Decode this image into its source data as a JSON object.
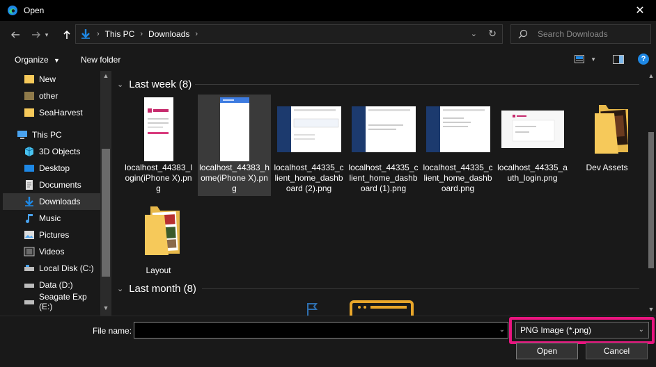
{
  "window": {
    "title": "Open"
  },
  "address": {
    "crumbs": [
      "This PC",
      "Downloads"
    ],
    "search_placeholder": "Search Downloads"
  },
  "toolbar": {
    "organize_label": "Organize",
    "new_folder_label": "New folder",
    "help_glyph": "?"
  },
  "sidebar": {
    "items": [
      {
        "label": "New",
        "icon": "folder-yellow-icon"
      },
      {
        "label": "other",
        "icon": "folder-yellow-icon"
      },
      {
        "label": "SeaHarvest",
        "icon": "folder-yellow-icon"
      },
      {
        "label": "This PC",
        "icon": "computer-icon"
      },
      {
        "label": "3D Objects",
        "icon": "cube-icon"
      },
      {
        "label": "Desktop",
        "icon": "desktop-icon"
      },
      {
        "label": "Documents",
        "icon": "documents-icon"
      },
      {
        "label": "Downloads",
        "icon": "download-arrow-icon",
        "selected": true
      },
      {
        "label": "Music",
        "icon": "music-note-icon"
      },
      {
        "label": "Pictures",
        "icon": "pictures-icon"
      },
      {
        "label": "Videos",
        "icon": "video-icon"
      },
      {
        "label": "Local Disk (C:)",
        "icon": "drive-icon"
      },
      {
        "label": "Data (D:)",
        "icon": "drive-icon"
      },
      {
        "label": "Seagate Exp (E:)",
        "icon": "drive-icon"
      }
    ]
  },
  "groups": [
    {
      "label": "Last week (8)"
    },
    {
      "label": "Last month (8)"
    }
  ],
  "files": [
    {
      "label": "localhost_44383_login(iPhone X).png",
      "kind": "phone-login"
    },
    {
      "label": "localhost_44383_home(iPhone X).png",
      "kind": "phone-home",
      "selected": true
    },
    {
      "label": "localhost_44335_client_home_dashboard (2).png",
      "kind": "dashboard"
    },
    {
      "label": "localhost_44335_client_home_dashboard (1).png",
      "kind": "dashboard"
    },
    {
      "label": "localhost_44335_client_home_dashboard.png",
      "kind": "dashboard"
    },
    {
      "label": "localhost_44335_auth_login.png",
      "kind": "auth-login"
    },
    {
      "label": "Dev Assets",
      "kind": "folder-dark"
    },
    {
      "label": "Layout",
      "kind": "folder-layout"
    }
  ],
  "bottom": {
    "file_name_label": "File name:",
    "file_name_value": "",
    "file_type": "PNG Image (*.png)",
    "open_label": "Open",
    "cancel_label": "Cancel"
  },
  "colors": {
    "highlight": "#e8157f",
    "accent_blue": "#1e88e5",
    "folder_yellow": "#f6c95a"
  }
}
